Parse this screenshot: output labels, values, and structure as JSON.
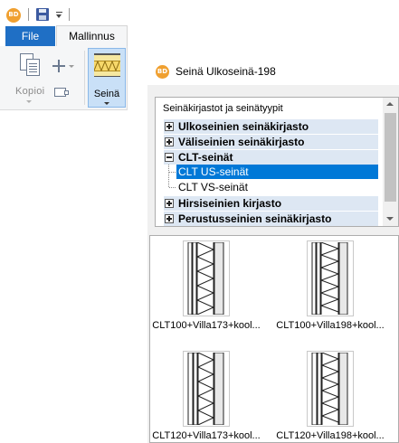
{
  "app": {
    "logo_text": "BD"
  },
  "ribbon": {
    "tabs": [
      {
        "label": "File"
      },
      {
        "label": "Mallinnus"
      }
    ],
    "kopioi_label": "Kopioi",
    "seina_label": "Seinä"
  },
  "dialog": {
    "title": "Seinä Ulkoseinä-198",
    "tree": {
      "header": "Seinäkirjastot ja seinätyypit",
      "items": [
        {
          "label": "Ulkoseinien seinäkirjasto"
        },
        {
          "label": "Väliseinien seinäkirjasto"
        },
        {
          "label": "CLT-seinät"
        },
        {
          "label": "CLT US-seinät"
        },
        {
          "label": "CLT VS-seinät"
        },
        {
          "label": "Hirsiseinien kirjasto"
        },
        {
          "label": "Perustusseinien seinäkirjasto"
        }
      ]
    },
    "thumbnails": [
      {
        "label": "CLT100+Villa173+kool..."
      },
      {
        "label": "CLT100+Villa198+kool..."
      },
      {
        "label": "CLT120+Villa173+kool..."
      },
      {
        "label": "CLT120+Villa198+kool..."
      }
    ]
  },
  "colors": {
    "accent": "#1f6fc5",
    "selection": "#0078d7",
    "group_row": "#dde7f3",
    "ribbon_pressed": "#c9e0f7"
  }
}
